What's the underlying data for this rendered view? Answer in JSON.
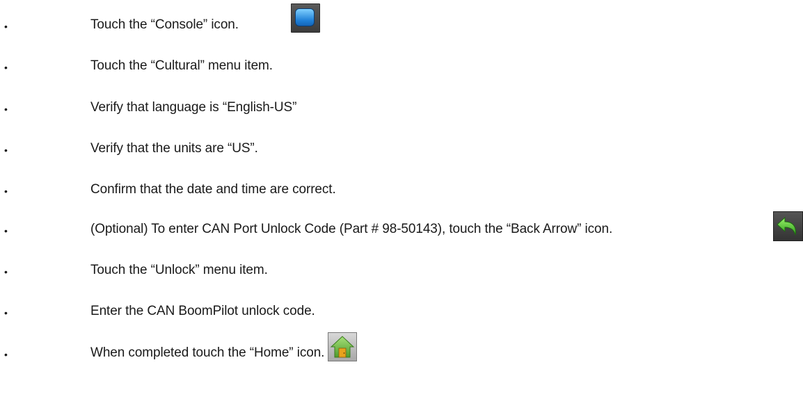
{
  "instructions": [
    {
      "bullet": "•",
      "text": "Touch the “Console” icon.",
      "icon": "console-icon"
    },
    {
      "bullet": "•",
      "text": "Touch the “Cultural” menu item."
    },
    {
      "bullet": "•",
      "text": "Verify that language is “English-US”"
    },
    {
      "bullet": "•",
      "text": "Verify that the units are “US”."
    },
    {
      "bullet": "•",
      "text": "Confirm that the date and time are correct."
    },
    {
      "bullet": "•",
      "text": "(Optional) To enter CAN Port Unlock Code (Part # 98-50143), touch the “Back Arrow” icon.",
      "icon": "back-arrow-icon"
    },
    {
      "bullet": "•",
      "text": "Touch the “Unlock” menu item."
    },
    {
      "bullet": "•",
      "text": "Enter the CAN BoomPilot unlock code."
    },
    {
      "bullet": "•",
      "text": "When completed touch the “Home” icon.",
      "icon": "home-icon"
    }
  ],
  "colors": {
    "text": "#1a1a1a",
    "console_screen": "#1e7fd6",
    "back_arrow": "#4fcf2f",
    "home_house": "#6fbf3f"
  }
}
